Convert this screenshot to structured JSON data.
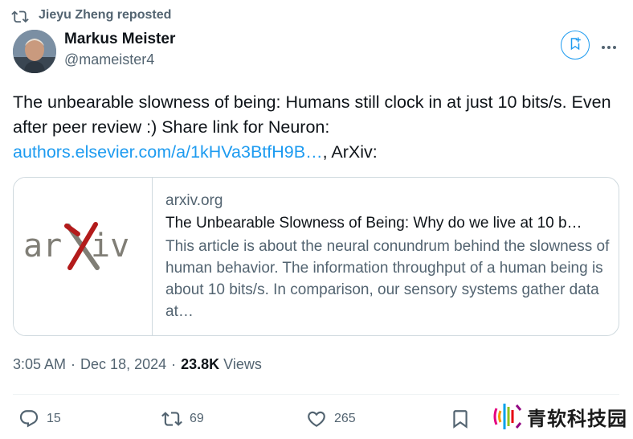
{
  "repost": {
    "label": "Jieyu Zheng reposted"
  },
  "author": {
    "name": "Markus Meister",
    "handle": "@mameister4"
  },
  "tweet": {
    "text_part1": "The unbearable slowness of being: Humans still clock in at just 10 bits/s. Even after peer review :) Share link for Neuron: ",
    "link_text": "authors.elsevier.com/a/1kHVa3BtfH9B…",
    "text_part2": ", ArXiv:"
  },
  "card": {
    "logo_text": "arXiv",
    "domain": "arxiv.org",
    "title": "The Unbearable Slowness of Being: Why do we live at 10 b…",
    "description": "This article is about the neural conundrum behind the slowness of human behavior. The information throughput of a human being is about 10 bits/s. In comparison, our sensory systems gather data at…"
  },
  "meta": {
    "time": "3:05 AM",
    "separator1": "·",
    "date": "Dec 18, 2024",
    "separator2": "·",
    "views_count": "23.8K",
    "views_label": "Views"
  },
  "actions": {
    "replies": "15",
    "reposts": "69",
    "likes": "265"
  },
  "watermark": {
    "text": "青软科技园"
  },
  "icons": {
    "repost": "repost-icon",
    "grok": "grok-bookmark-icon",
    "more": "more-icon",
    "reply": "reply-icon",
    "like": "heart-icon",
    "bookmark": "bookmark-icon"
  },
  "colors": {
    "accent": "#1d9bf0",
    "secondary_text": "#536471",
    "primary_text": "#0f1419",
    "arxiv_red": "#b31b1b",
    "arxiv_gray": "#807e76"
  }
}
